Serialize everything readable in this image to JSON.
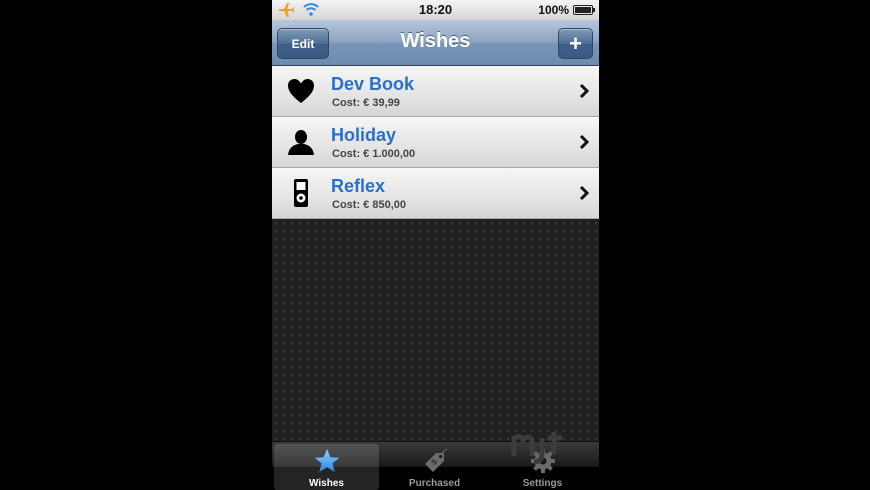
{
  "statusbar": {
    "time": "18:20",
    "battery": "100%",
    "icons": [
      "airplane-icon",
      "wifi-icon",
      "battery-icon"
    ]
  },
  "navbar": {
    "title": "Wishes",
    "edit_label": "Edit",
    "add_label": "+"
  },
  "wishes": [
    {
      "title": "Dev Book",
      "cost": "Cost: € 39,99",
      "icon": "heart-icon"
    },
    {
      "title": "Holiday",
      "cost": "Cost: € 1.000,00",
      "icon": "person-icon"
    },
    {
      "title": "Reflex",
      "cost": "Cost: € 850,00",
      "icon": "ipod-icon"
    }
  ],
  "tabbar": {
    "tabs": [
      {
        "label": "Wishes",
        "icon": "star-icon",
        "active": true
      },
      {
        "label": "Purchased",
        "icon": "price-tag-icon",
        "active": false
      },
      {
        "label": "Settings",
        "icon": "gear-icon",
        "active": false
      }
    ]
  },
  "colors": {
    "title_blue": "#2a6fc9",
    "navbar": "#7a96b6",
    "tab_active_icon": "#4a9ff5",
    "plane": "#f0a020"
  }
}
